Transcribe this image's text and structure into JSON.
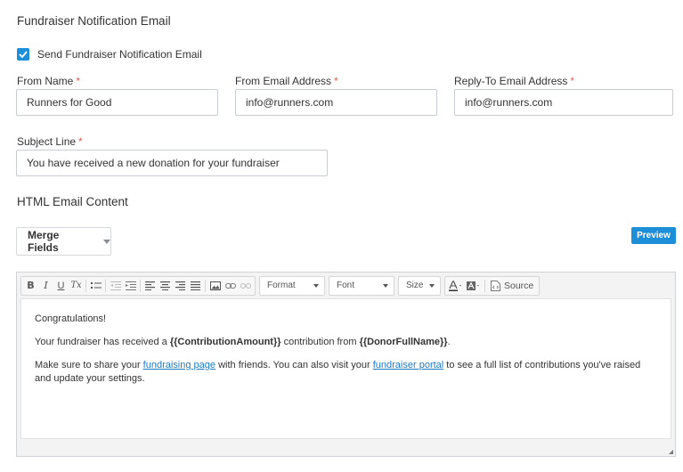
{
  "section_title": "Fundraiser Notification Email",
  "send_checkbox": {
    "label": "Send Fundraiser Notification Email",
    "checked": true
  },
  "fields": {
    "from_name": {
      "label": "From Name",
      "required": "*",
      "value": "Runners for Good"
    },
    "from_email": {
      "label": "From Email Address",
      "required": "*",
      "value": "info@runners.com"
    },
    "reply_to": {
      "label": "Reply-To Email Address",
      "required": "*",
      "value": "info@runners.com"
    },
    "subject": {
      "label": "Subject Line",
      "required": "*",
      "value": "You have received a new donation for your fundraiser"
    }
  },
  "html_content_title": "HTML Email Content",
  "merge_fields_label": "Merge Fields",
  "preview_label": "Preview",
  "toolbar": {
    "bold": "B",
    "italic": "I",
    "underline": "U",
    "clear_format": "Tx",
    "format": "Format",
    "font": "Font",
    "size": "Size",
    "source": "Source"
  },
  "email_body": {
    "p1": "Congratulations!",
    "p2_before": "Your fundraiser has received a ",
    "p2_merge1": "{{ContributionAmount}}",
    "p2_mid": " contribution from ",
    "p2_merge2": "{{DonorFullName}}",
    "p2_after": ".",
    "p3_before": "Make sure to share your ",
    "p3_link1": "fundraising page",
    "p3_mid": " with friends. You can also visit your ",
    "p3_link2": "fundraiser portal",
    "p3_after": " to see a full list of contributions you've raised and update your settings."
  },
  "colors": {
    "accent": "#1d8ed8",
    "required": "#e0605a",
    "link": "#1d7ac0"
  }
}
